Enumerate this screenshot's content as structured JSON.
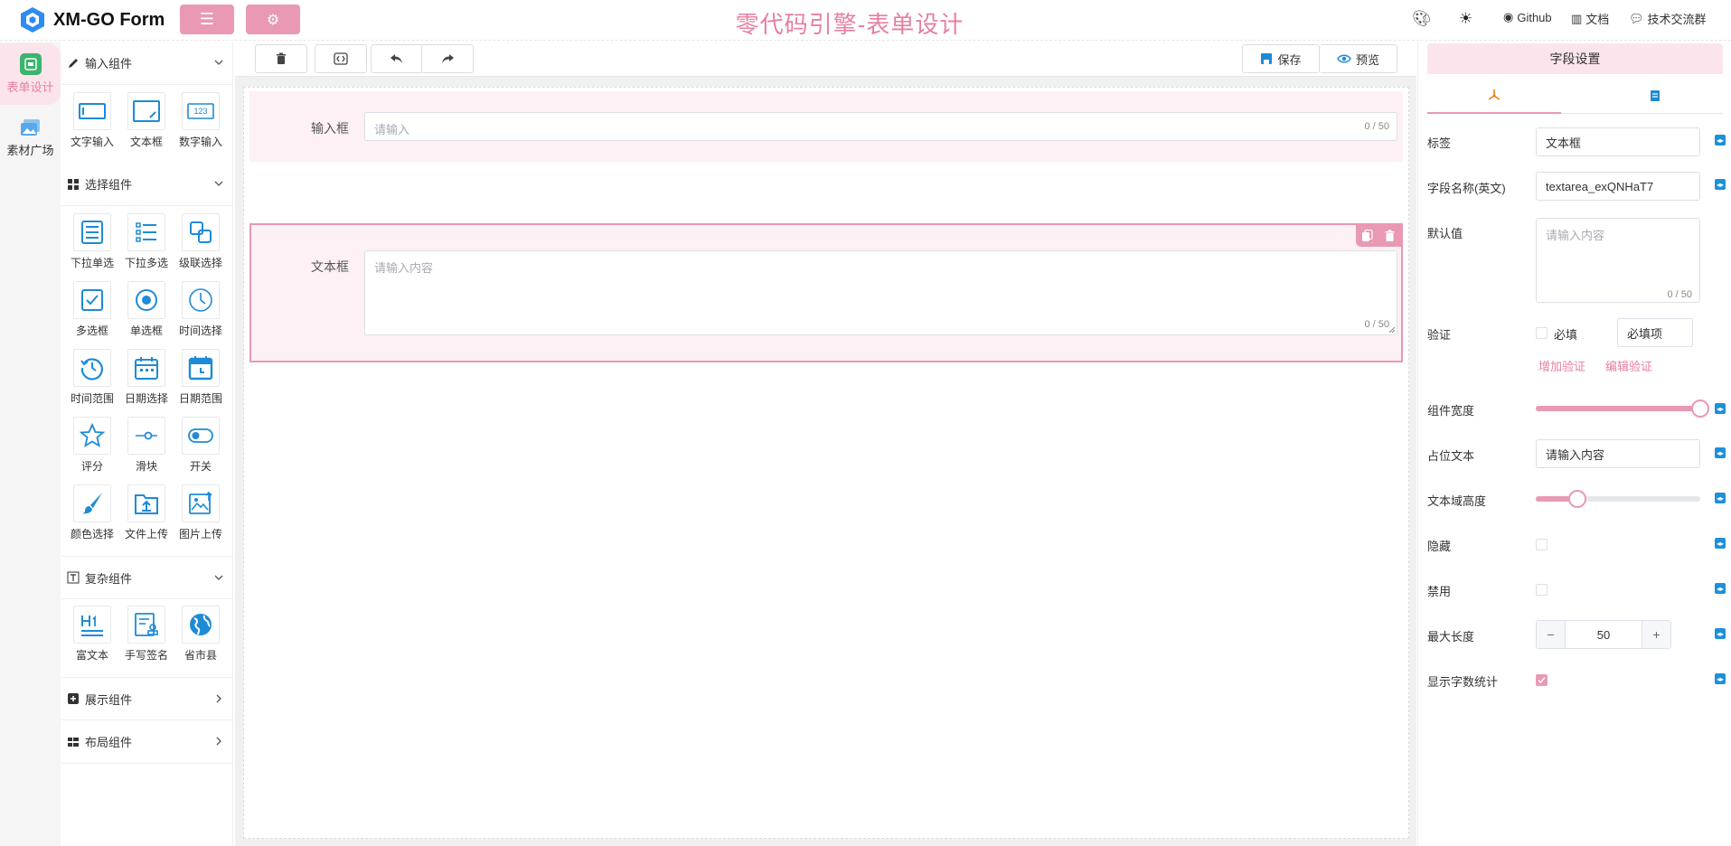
{
  "header": {
    "brand": "XM-GO Form",
    "title": "零代码引擎-表单设计",
    "links": {
      "github": "Github",
      "docs": "文档",
      "community": "技术交流群"
    },
    "accent": "#e999b3"
  },
  "leftnav": {
    "items": [
      {
        "label": "表单设计"
      },
      {
        "label": "素材广场"
      }
    ]
  },
  "components": {
    "groups": {
      "input": "输入组件",
      "select": "选择组件",
      "complex": "复杂组件",
      "display": "展示组件",
      "layout": "布局组件"
    },
    "input_items": [
      "文字输入",
      "文本框",
      "数字输入"
    ],
    "select_items": [
      "下拉单选",
      "下拉多选",
      "级联选择",
      "多选框",
      "单选框",
      "时间选择",
      "时间范围",
      "日期选择",
      "日期范围",
      "评分",
      "滑块",
      "开关",
      "颜色选择",
      "文件上传",
      "图片上传"
    ],
    "complex_items": [
      "富文本",
      "手写签名",
      "省市县"
    ],
    "number_icon_text": "123"
  },
  "toolbar": {
    "save": "保存",
    "preview": "预览"
  },
  "canvas": {
    "field1": {
      "label": "输入框",
      "placeholder": "请输入",
      "count": "0 / 50"
    },
    "field2": {
      "label": "文本框",
      "placeholder": "请输入内容",
      "count": "0 / 50"
    }
  },
  "panel": {
    "title": "字段设置",
    "label_label": "标签",
    "label_value": "文本框",
    "name_label": "字段名称(英文)",
    "name_value": "textarea_exQNHaT7",
    "default_label": "默认值",
    "default_placeholder": "请输入内容",
    "default_count": "0 / 50",
    "validate_label": "验证",
    "required_label": "必填",
    "required_msg": "必填项",
    "add_validate": "增加验证",
    "edit_validate": "编辑验证",
    "width_label": "组件宽度",
    "width_value": 1.0,
    "placeholder_label": "占位文本",
    "placeholder_value": "请输入内容",
    "height_label": "文本域高度",
    "height_value": 0.25,
    "hidden_label": "隐藏",
    "disabled_label": "禁用",
    "maxlen_label": "最大长度",
    "maxlen_value": "50",
    "minus": "−",
    "plus": "+",
    "showcount_label": "显示字数统计",
    "showcount_checked": true
  }
}
